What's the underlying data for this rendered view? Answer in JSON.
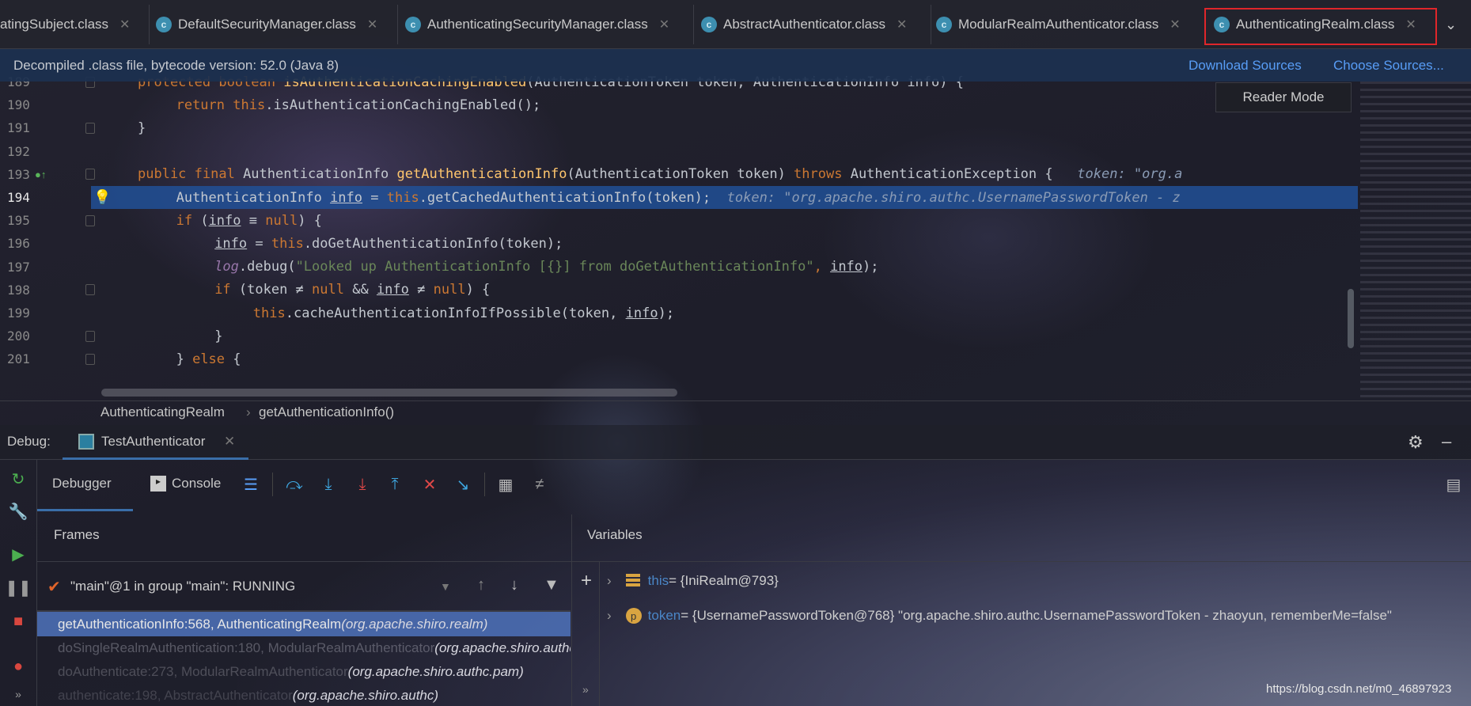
{
  "tabs": [
    {
      "label": "atingSubject.class",
      "icon": "class-icon",
      "active": false
    },
    {
      "label": "DefaultSecurityManager.class",
      "icon": "class-icon",
      "active": false
    },
    {
      "label": "AuthenticatingSecurityManager.class",
      "icon": "class-icon",
      "active": false
    },
    {
      "label": "AbstractAuthenticator.class",
      "icon": "class-icon",
      "active": false
    },
    {
      "label": "ModularRealmAuthenticator.class",
      "icon": "class-icon",
      "active": false
    },
    {
      "label": "AuthenticatingRealm.class",
      "icon": "class-icon",
      "active": true
    }
  ],
  "infobar": {
    "text": "Decompiled .class file, bytecode version: 52.0 (Java 8)",
    "download": "Download Sources",
    "choose": "Choose Sources..."
  },
  "reader_mode": "Reader Mode",
  "code": {
    "current_line": 194,
    "lines": [
      {
        "n": "189",
        "spans": [
          [
            "k",
            "protected boolean "
          ],
          [
            "m",
            "isAuthenticationCachingEnabled"
          ],
          [
            "",
            "(AuthenticationToken token, AuthenticationInfo info) {"
          ]
        ],
        "indent": 0
      },
      {
        "n": "190",
        "spans": [
          [
            "k",
            "return this"
          ],
          [
            "",
            "."
          ],
          [
            "",
            "isAuthenticationCachingEnabled();"
          ]
        ],
        "indent": 1
      },
      {
        "n": "191",
        "spans": [
          [
            "",
            "}"
          ]
        ],
        "indent": 0
      },
      {
        "n": "192",
        "spans": [],
        "indent": 0
      },
      {
        "n": "193",
        "spans": [
          [
            "k",
            "public final "
          ],
          [
            "",
            "AuthenticationInfo "
          ],
          [
            "m",
            "getAuthenticationInfo"
          ],
          [
            "",
            "(AuthenticationToken token) "
          ],
          [
            "k",
            "throws "
          ],
          [
            "",
            "AuthenticationException {   "
          ],
          [
            "h",
            "token: \"org.a"
          ]
        ],
        "indent": 0
      },
      {
        "n": "194",
        "spans": [
          [
            "",
            "AuthenticationInfo "
          ],
          [
            "u",
            "info"
          ],
          [
            "",
            " = "
          ],
          [
            "k",
            "this"
          ],
          [
            "",
            ".getCachedAuthenticationInfo(token);  "
          ],
          [
            "h",
            "token: \"org.apache.shiro.authc.UsernamePasswordToken - z"
          ]
        ],
        "indent": 1
      },
      {
        "n": "195",
        "spans": [
          [
            "k",
            "if "
          ],
          [
            "",
            "("
          ],
          [
            "u",
            "info"
          ],
          [
            "",
            " ≡ "
          ],
          [
            "k",
            "null"
          ],
          [
            "",
            ") {"
          ]
        ],
        "indent": 1
      },
      {
        "n": "196",
        "spans": [
          [
            "u",
            "info"
          ],
          [
            "",
            " = "
          ],
          [
            "k",
            "this"
          ],
          [
            "",
            ".doGetAuthenticationInfo(token);"
          ]
        ],
        "indent": 2
      },
      {
        "n": "197",
        "spans": [
          [
            "f",
            "log"
          ],
          [
            "",
            ".debug("
          ],
          [
            "s",
            "\"Looked up AuthenticationInfo [{}] from doGetAuthenticationInfo\""
          ],
          [
            "k",
            ", "
          ],
          [
            "u",
            "info"
          ],
          [
            "",
            ");"
          ]
        ],
        "indent": 2
      },
      {
        "n": "198",
        "spans": [
          [
            "k",
            "if "
          ],
          [
            "",
            "(token ≠ "
          ],
          [
            "k",
            "null "
          ],
          [
            "",
            "&& "
          ],
          [
            "u",
            "info"
          ],
          [
            "",
            " ≠ "
          ],
          [
            "k",
            "null"
          ],
          [
            "",
            ") {"
          ]
        ],
        "indent": 2
      },
      {
        "n": "199",
        "spans": [
          [
            "k",
            "this"
          ],
          [
            "",
            ".cacheAuthenticationInfoIfPossible(token, "
          ],
          [
            "u",
            "info"
          ],
          [
            "",
            ");"
          ]
        ],
        "indent": 3
      },
      {
        "n": "200",
        "spans": [
          [
            "",
            "}"
          ]
        ],
        "indent": 2
      },
      {
        "n": "201",
        "spans": [
          [
            "",
            "} "
          ],
          [
            "k",
            "else "
          ],
          [
            "",
            "{"
          ]
        ],
        "indent": 1
      }
    ]
  },
  "breadcrumb": [
    "AuthenticatingRealm",
    "getAuthenticationInfo()"
  ],
  "debug": {
    "label": "Debug:",
    "session_tab": "TestAuthenticator",
    "debugger_tab": "Debugger",
    "console_tab": "Console",
    "frames_title": "Frames",
    "variables_title": "Variables",
    "thread": "\"main\"@1 in group \"main\": RUNNING",
    "frames": [
      {
        "method": "getAuthenticationInfo:568, AuthenticatingRealm ",
        "pkg": "(org.apache.shiro.realm)",
        "selected": true
      },
      {
        "method": "doSingleRealmAuthentication:180, ModularRealmAuthenticator ",
        "pkg": "(org.apache.shiro.authc.pam)",
        "selected": false
      },
      {
        "method": "doAuthenticate:273, ModularRealmAuthenticator ",
        "pkg": "(org.apache.shiro.authc.pam)",
        "selected": false
      },
      {
        "method": "authenticate:198, AbstractAuthenticator ",
        "pkg": "(org.apache.shiro.authc)",
        "selected": false
      }
    ],
    "variables": [
      {
        "name": "this",
        "value": " = {IniRealm@793}",
        "icon": "field-icon"
      },
      {
        "name": "token",
        "value": " = {UsernamePasswordToken@768} \"org.apache.shiro.authc.UsernamePasswordToken - zhaoyun, rememberMe=false\"",
        "icon": "parameter-icon"
      }
    ]
  },
  "watermark": "https://blog.csdn.net/m0_46897923",
  "colors": {
    "accent": "#589df6",
    "highlight": "#2150a0",
    "active_tab_outline": "#e0262a",
    "keyword": "#cc7832",
    "method": "#ffc66d",
    "string": "#6a8759"
  }
}
